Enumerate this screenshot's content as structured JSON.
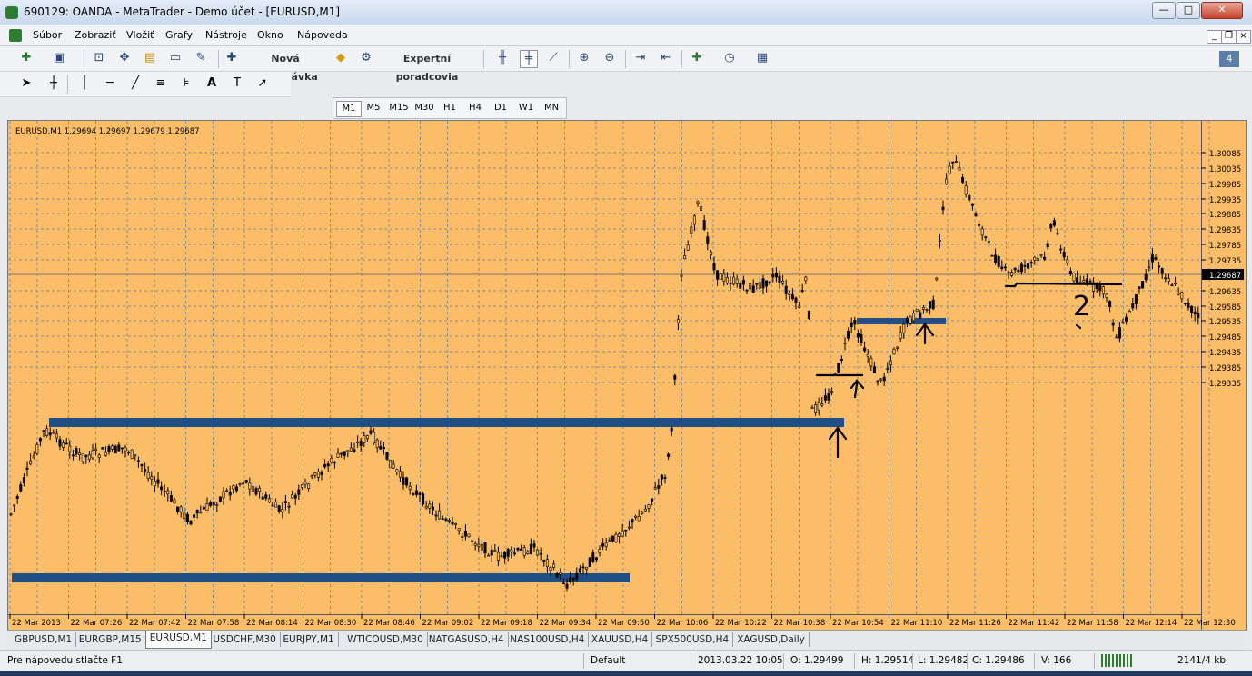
{
  "window": {
    "title": "690129: OANDA - MetaTrader - Demo účet - [EURUSD,M1]",
    "minimize": "—",
    "maximize": "□",
    "close": "✕"
  },
  "menu": [
    "Súbor",
    "Zobraziť",
    "Vložiť",
    "Grafy",
    "Nástroje",
    "Okno",
    "Nápoveda"
  ],
  "toolbar": {
    "new_order": "Nová objednávka",
    "experts": "Expertní poradcovia",
    "notification_count": "4"
  },
  "timeframes": {
    "items": [
      "M1",
      "M5",
      "M15",
      "M30",
      "H1",
      "H4",
      "D1",
      "W1",
      "MN"
    ],
    "active": "M1"
  },
  "chart": {
    "header": "EURUSD,M1  1.29694 1.29697 1.29679 1.29687",
    "current_price": "1.29687",
    "price_labels": [
      "1.30085",
      "1.30035",
      "1.29985",
      "1.29935",
      "1.29885",
      "1.29835",
      "1.29785",
      "1.29735",
      "1.29635",
      "1.29585",
      "1.29535",
      "1.29485",
      "1.29435",
      "1.29385",
      "1.29335"
    ],
    "time_labels": [
      "22 Mar 2013",
      "22 Mar 07:26",
      "22 Mar 07:42",
      "22 Mar 07:58",
      "22 Mar 08:14",
      "22 Mar 08:30",
      "22 Mar 08:46",
      "22 Mar 09:02",
      "22 Mar 09:18",
      "22 Mar 09:34",
      "22 Mar 09:50",
      "22 Mar 10:06",
      "22 Mar 10:22",
      "22 Mar 10:38",
      "22 Mar 10:54",
      "22 Mar 11:10",
      "22 Mar 11:26",
      "22 Mar 11:42",
      "22 Mar 11:58",
      "22 Mar 12:14",
      "22 Mar 12:30"
    ],
    "annotation_label": "2",
    "colors": {
      "background": "#fbbd68",
      "zone": "#1f4f84",
      "candle": "#000000",
      "grid": "#8c8c8c"
    }
  },
  "tabs": {
    "items": [
      "GBPUSD,M1",
      "EURGBP,M15",
      "EURUSD,M1",
      "USDCHF,M30",
      "EURJPY,M1",
      "WTICOUSD,M30",
      "NATGASUSD,H4",
      "NAS100USD,H4",
      "XAUUSD,H4",
      "SPX500USD,H4",
      "XAGUSD,Daily"
    ],
    "active": "EURUSD,M1"
  },
  "status": {
    "help": "Pre nápovedu stlačte F1",
    "profile": "Default",
    "datetime": "2013.03.22 10:05",
    "open": "O: 1.29499",
    "high": "H: 1.29514",
    "low": "L: 1.29482",
    "close": "C: 1.29486",
    "volume": "V: 166",
    "traffic": "2141/4 kb"
  }
}
